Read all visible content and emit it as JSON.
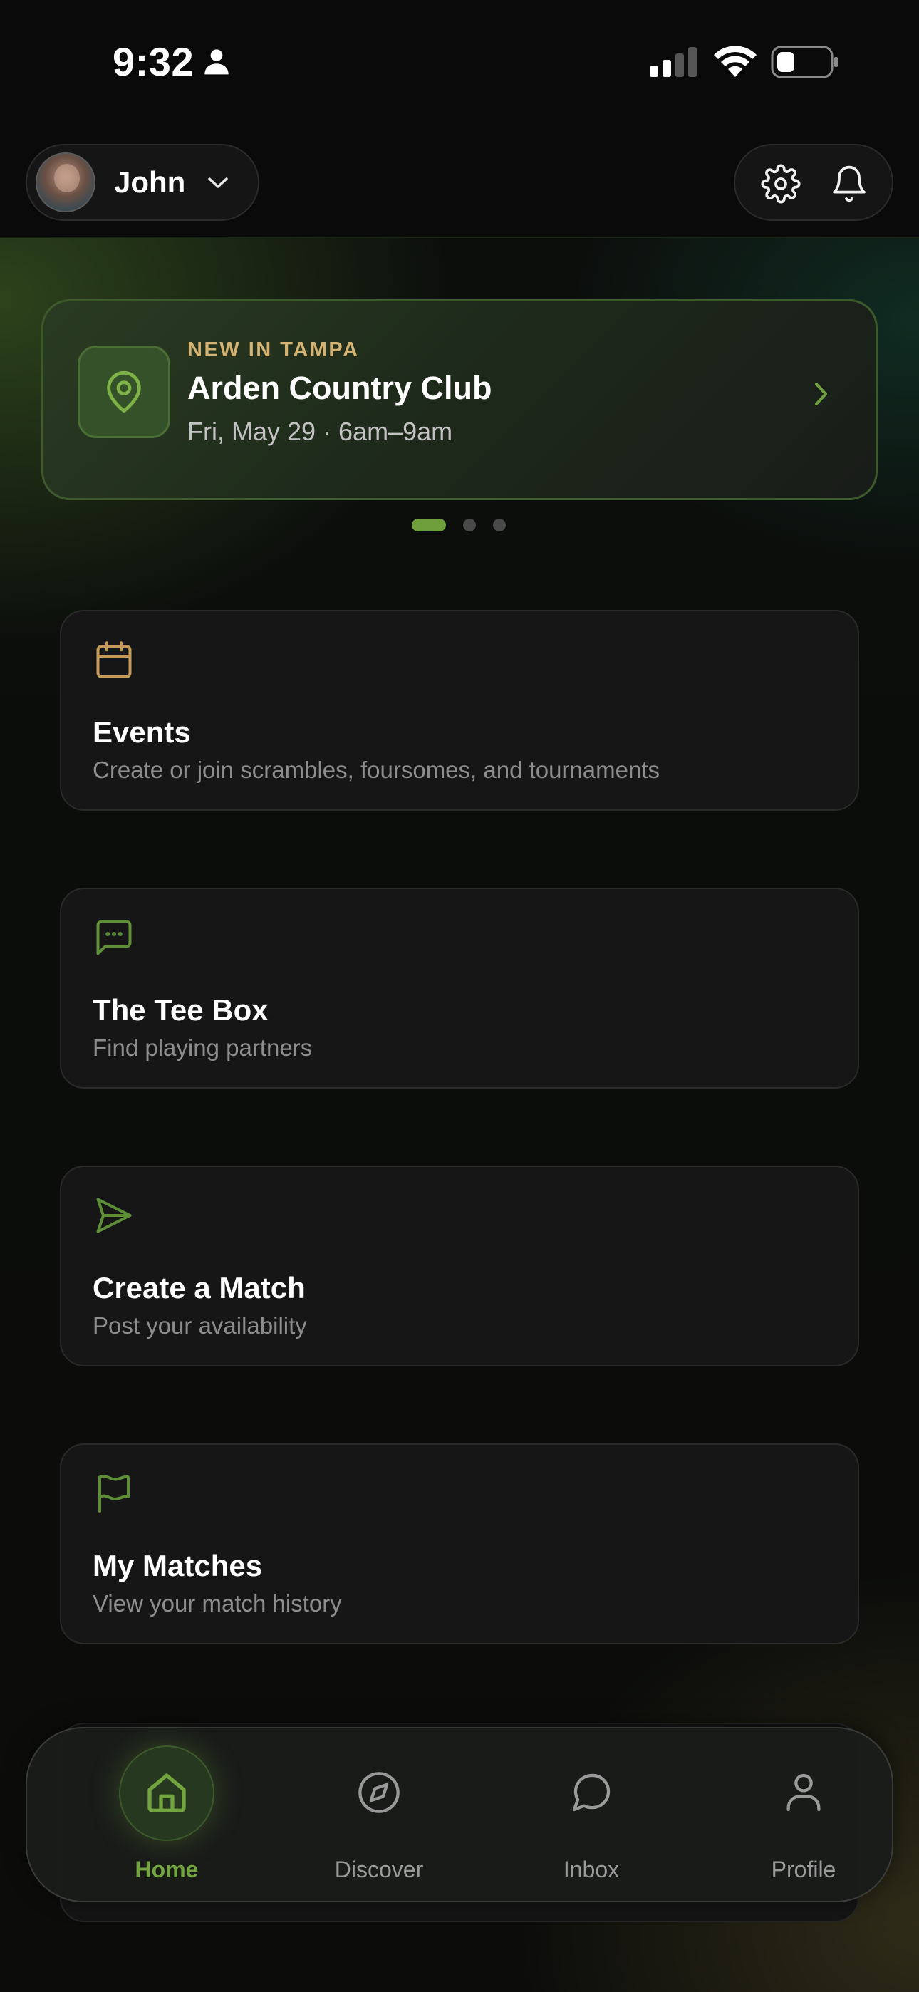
{
  "status_bar": {
    "time": "9:32"
  },
  "header": {
    "user_name": "John",
    "icons": [
      "person-icon",
      "chevron-down-icon",
      "gear-icon",
      "bell-icon"
    ]
  },
  "promo": {
    "kicker": "NEW IN TAMPA",
    "title": "Arden Country Club",
    "subtitle": "Fri, May 29 · 6am–9am",
    "carousel_pages": 3,
    "active_page": 1
  },
  "cards": [
    {
      "title": "Events",
      "subtitle": "Create or join scrambles, foursomes, and tournaments",
      "icon": "calendar-icon"
    },
    {
      "title": "The Tee Box",
      "subtitle": "Find playing partners",
      "icon": "chat-bubble-icon"
    },
    {
      "title": "Create a Match",
      "subtitle": "Post your availability",
      "icon": "send-icon"
    },
    {
      "title": "My Matches",
      "subtitle": "View your match history",
      "icon": "flag-icon"
    }
  ],
  "tabbar": {
    "tabs": [
      {
        "label": "Home",
        "icon": "home-icon",
        "active": true
      },
      {
        "label": "Discover",
        "icon": "compass-icon",
        "active": false
      },
      {
        "label": "Inbox",
        "icon": "message-icon",
        "active": false
      },
      {
        "label": "Profile",
        "icon": "person-icon",
        "active": false
      }
    ]
  },
  "colors": {
    "accent_green": "#72a43f",
    "kicker_gold": "#d4b271",
    "card_bg": "#161616"
  }
}
